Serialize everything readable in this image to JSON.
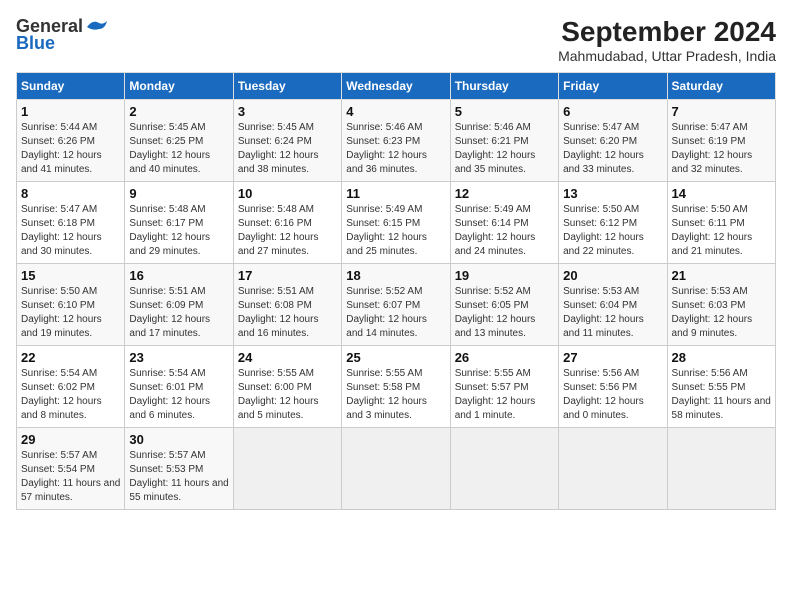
{
  "header": {
    "logo_line1": "General",
    "logo_line2": "Blue",
    "title": "September 2024",
    "subtitle": "Mahmudabad, Uttar Pradesh, India"
  },
  "weekdays": [
    "Sunday",
    "Monday",
    "Tuesday",
    "Wednesday",
    "Thursday",
    "Friday",
    "Saturday"
  ],
  "weeks": [
    [
      {
        "day": "1",
        "sunrise": "5:44 AM",
        "sunset": "6:26 PM",
        "daylight": "12 hours and 41 minutes."
      },
      {
        "day": "2",
        "sunrise": "5:45 AM",
        "sunset": "6:25 PM",
        "daylight": "12 hours and 40 minutes."
      },
      {
        "day": "3",
        "sunrise": "5:45 AM",
        "sunset": "6:24 PM",
        "daylight": "12 hours and 38 minutes."
      },
      {
        "day": "4",
        "sunrise": "5:46 AM",
        "sunset": "6:23 PM",
        "daylight": "12 hours and 36 minutes."
      },
      {
        "day": "5",
        "sunrise": "5:46 AM",
        "sunset": "6:21 PM",
        "daylight": "12 hours and 35 minutes."
      },
      {
        "day": "6",
        "sunrise": "5:47 AM",
        "sunset": "6:20 PM",
        "daylight": "12 hours and 33 minutes."
      },
      {
        "day": "7",
        "sunrise": "5:47 AM",
        "sunset": "6:19 PM",
        "daylight": "12 hours and 32 minutes."
      }
    ],
    [
      {
        "day": "8",
        "sunrise": "5:47 AM",
        "sunset": "6:18 PM",
        "daylight": "12 hours and 30 minutes."
      },
      {
        "day": "9",
        "sunrise": "5:48 AM",
        "sunset": "6:17 PM",
        "daylight": "12 hours and 29 minutes."
      },
      {
        "day": "10",
        "sunrise": "5:48 AM",
        "sunset": "6:16 PM",
        "daylight": "12 hours and 27 minutes."
      },
      {
        "day": "11",
        "sunrise": "5:49 AM",
        "sunset": "6:15 PM",
        "daylight": "12 hours and 25 minutes."
      },
      {
        "day": "12",
        "sunrise": "5:49 AM",
        "sunset": "6:14 PM",
        "daylight": "12 hours and 24 minutes."
      },
      {
        "day": "13",
        "sunrise": "5:50 AM",
        "sunset": "6:12 PM",
        "daylight": "12 hours and 22 minutes."
      },
      {
        "day": "14",
        "sunrise": "5:50 AM",
        "sunset": "6:11 PM",
        "daylight": "12 hours and 21 minutes."
      }
    ],
    [
      {
        "day": "15",
        "sunrise": "5:50 AM",
        "sunset": "6:10 PM",
        "daylight": "12 hours and 19 minutes."
      },
      {
        "day": "16",
        "sunrise": "5:51 AM",
        "sunset": "6:09 PM",
        "daylight": "12 hours and 17 minutes."
      },
      {
        "day": "17",
        "sunrise": "5:51 AM",
        "sunset": "6:08 PM",
        "daylight": "12 hours and 16 minutes."
      },
      {
        "day": "18",
        "sunrise": "5:52 AM",
        "sunset": "6:07 PM",
        "daylight": "12 hours and 14 minutes."
      },
      {
        "day": "19",
        "sunrise": "5:52 AM",
        "sunset": "6:05 PM",
        "daylight": "12 hours and 13 minutes."
      },
      {
        "day": "20",
        "sunrise": "5:53 AM",
        "sunset": "6:04 PM",
        "daylight": "12 hours and 11 minutes."
      },
      {
        "day": "21",
        "sunrise": "5:53 AM",
        "sunset": "6:03 PM",
        "daylight": "12 hours and 9 minutes."
      }
    ],
    [
      {
        "day": "22",
        "sunrise": "5:54 AM",
        "sunset": "6:02 PM",
        "daylight": "12 hours and 8 minutes."
      },
      {
        "day": "23",
        "sunrise": "5:54 AM",
        "sunset": "6:01 PM",
        "daylight": "12 hours and 6 minutes."
      },
      {
        "day": "24",
        "sunrise": "5:55 AM",
        "sunset": "6:00 PM",
        "daylight": "12 hours and 5 minutes."
      },
      {
        "day": "25",
        "sunrise": "5:55 AM",
        "sunset": "5:58 PM",
        "daylight": "12 hours and 3 minutes."
      },
      {
        "day": "26",
        "sunrise": "5:55 AM",
        "sunset": "5:57 PM",
        "daylight": "12 hours and 1 minute."
      },
      {
        "day": "27",
        "sunrise": "5:56 AM",
        "sunset": "5:56 PM",
        "daylight": "12 hours and 0 minutes."
      },
      {
        "day": "28",
        "sunrise": "5:56 AM",
        "sunset": "5:55 PM",
        "daylight": "11 hours and 58 minutes."
      }
    ],
    [
      {
        "day": "29",
        "sunrise": "5:57 AM",
        "sunset": "5:54 PM",
        "daylight": "11 hours and 57 minutes."
      },
      {
        "day": "30",
        "sunrise": "5:57 AM",
        "sunset": "5:53 PM",
        "daylight": "11 hours and 55 minutes."
      },
      null,
      null,
      null,
      null,
      null
    ]
  ]
}
